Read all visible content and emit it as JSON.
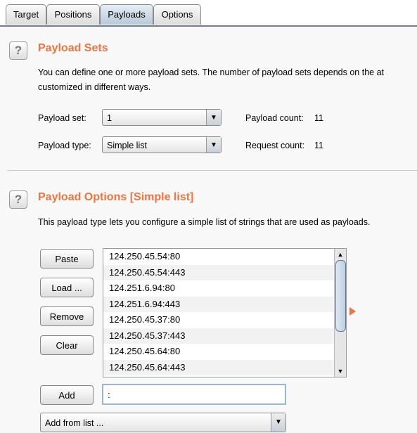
{
  "tabs": [
    {
      "label": "Target"
    },
    {
      "label": "Positions"
    },
    {
      "label": "Payloads",
      "active": true
    },
    {
      "label": "Options"
    }
  ],
  "payload_sets": {
    "title": "Payload Sets",
    "description1": "You can define one or more payload sets. The number of payload sets depends on the at",
    "description2": "customized in different ways.",
    "set_label": "Payload set:",
    "set_value": "1",
    "type_label": "Payload type:",
    "type_value": "Simple list",
    "payload_count_label": "Payload count:",
    "payload_count": "11",
    "request_count_label": "Request count:",
    "request_count": "11"
  },
  "payload_options": {
    "title": "Payload Options [Simple list]",
    "description": "This payload type lets you configure a simple list of strings that are used as payloads.",
    "buttons": {
      "paste": "Paste",
      "load": "Load ...",
      "remove": "Remove",
      "clear": "Clear",
      "add": "Add"
    },
    "items": [
      "124.250.45.54:80",
      "124.250.45.54:443",
      "124.251.6.94:80",
      "124.251.6.94:443",
      "124.250.45.37:80",
      "124.250.45.37:443",
      "124.250.45.64:80",
      "124.250.45.64:443"
    ],
    "add_value": ":",
    "add_from_list": "Add from list ..."
  },
  "colors": {
    "accent": "#f0743e"
  }
}
